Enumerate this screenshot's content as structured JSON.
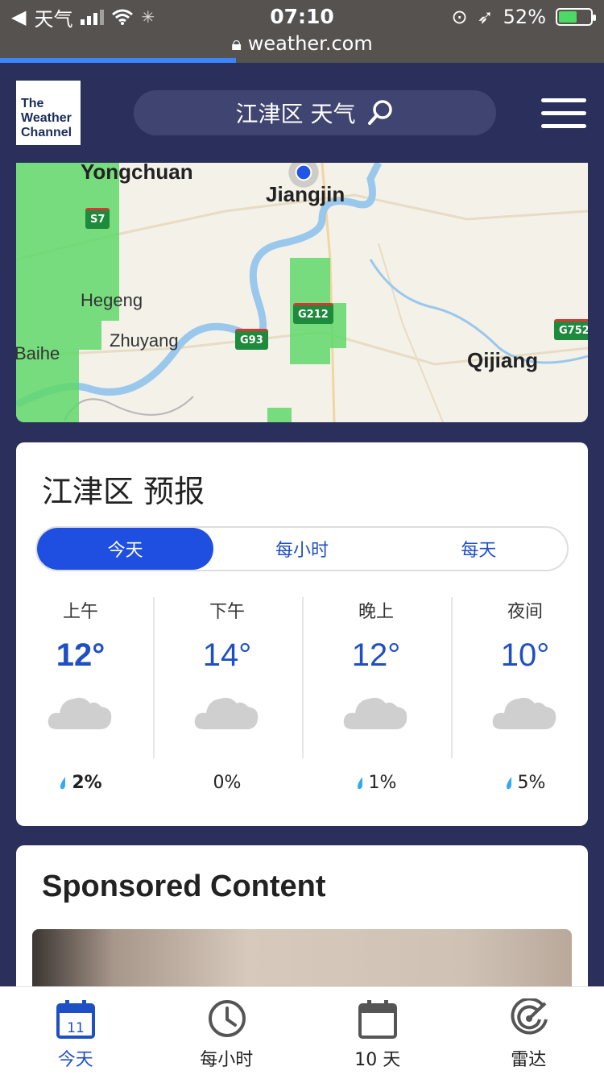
{
  "status_bar": {
    "back_app": "天气",
    "time": "07:10",
    "battery": "52%",
    "battery_level": 0.52,
    "url": "weather.com",
    "page_load_progress": 0.39
  },
  "header": {
    "logo_text": "The Weather Channel",
    "search_text": "江津区 天气",
    "search_icon": "search-icon",
    "menu_icon": "hamburger-icon"
  },
  "map": {
    "labels": {
      "yongchuan": "Yongchuan",
      "jiangjin": "Jiangjin",
      "hegeng": "Hegeng",
      "zhuyang": "Zhuyang",
      "baihe": "Baihe",
      "qijiang": "Qijiang"
    },
    "shields": {
      "s7": "S7",
      "g212": "G212",
      "g93": "G93",
      "g752": "G752"
    }
  },
  "forecast": {
    "title": "江津区 预报",
    "tabs": [
      "今天",
      "每小时",
      "每天"
    ],
    "active_tab": 0,
    "periods": [
      {
        "name": "上午",
        "temp": "12°",
        "rain": "2%",
        "icon": "cloud-icon"
      },
      {
        "name": "下午",
        "temp": "14°",
        "rain": "0%",
        "icon": "cloud-icon"
      },
      {
        "name": "晚上",
        "temp": "12°",
        "rain": "1%",
        "icon": "cloud-icon"
      },
      {
        "name": "夜间",
        "temp": "10°",
        "rain": "5%",
        "icon": "cloud-icon"
      }
    ]
  },
  "sponsored": {
    "title": "Sponsored Content"
  },
  "bottom_nav": {
    "items": [
      {
        "label": "今天",
        "icon": "calendar-day-icon",
        "day": "11"
      },
      {
        "label": "每小时",
        "icon": "clock-icon"
      },
      {
        "label": "10 天",
        "icon": "calendar-icon"
      },
      {
        "label": "雷达",
        "icon": "radar-icon"
      }
    ],
    "active": 0
  },
  "colors": {
    "header_bg": "#2a2f5b",
    "accent": "#1f4fe0",
    "temp_blue": "#1f4fc4",
    "radar_green": "#5fd86a"
  }
}
